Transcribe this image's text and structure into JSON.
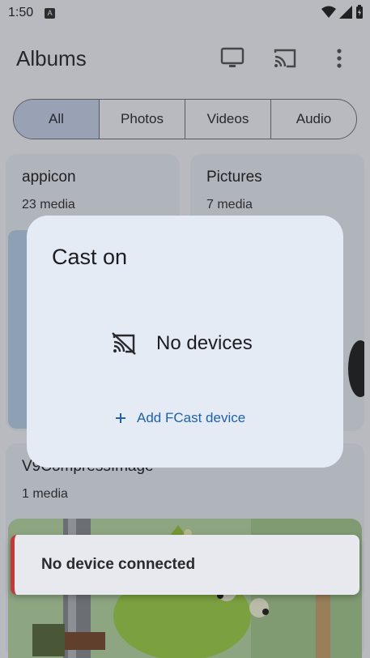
{
  "status_bar": {
    "time": "1:50",
    "notification_badge": "A"
  },
  "app_bar": {
    "title": "Albums",
    "icons": [
      "monitor-icon",
      "cast-icon",
      "overflow-menu-icon"
    ]
  },
  "filters": [
    "All",
    "Photos",
    "Videos",
    "Audio"
  ],
  "albums": [
    {
      "name": "appicon",
      "count": "23 media"
    },
    {
      "name": "Pictures",
      "count": "7 media"
    },
    {
      "name": "V9CompressImage",
      "count": "1 media"
    }
  ],
  "cast_dialog": {
    "title": "Cast on",
    "empty_text": "No devices",
    "add_label": "Add FCast device"
  },
  "toast": {
    "message": "No device connected"
  },
  "colors": {
    "accent": "#2161a6",
    "error_strip": "#c13a3a",
    "selected_segment": "#c9d5ea"
  }
}
